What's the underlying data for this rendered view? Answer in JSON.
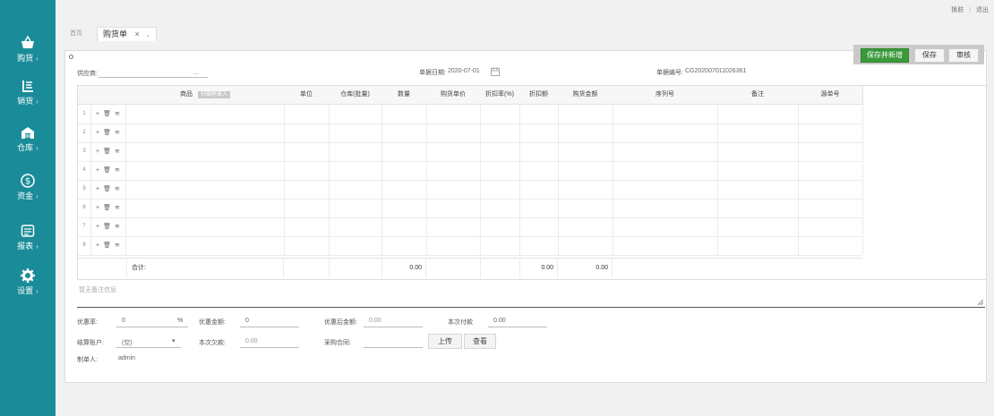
{
  "topbar": {
    "skin": "换肤",
    "separator": "|",
    "logout": "退出"
  },
  "sidebar": {
    "items": [
      {
        "label": "购货",
        "icon": "basket-icon"
      },
      {
        "label": "销货",
        "icon": "sales-icon"
      },
      {
        "label": "仓库",
        "icon": "warehouse-icon"
      },
      {
        "label": "资金",
        "icon": "dollar-icon"
      },
      {
        "label": "报表",
        "icon": "report-icon"
      },
      {
        "label": "设置",
        "icon": "gear-icon"
      }
    ],
    "arrow": "›"
  },
  "tabs": {
    "home": "首页",
    "active": "购货单",
    "close": "×",
    "more": "⌄"
  },
  "actions": {
    "save_new": "保存并新增",
    "save": "保存",
    "audit": "审核"
  },
  "header": {
    "supplier_label": "供应商:",
    "supplier_more": "...",
    "date_label": "单据日期:",
    "date_value": "2020-07-01",
    "number_label": "单据编号:",
    "number_value": "CG202007011026361"
  },
  "grid": {
    "columns": {
      "product": "商品",
      "scan": "扫描枪录入",
      "unit": "单位",
      "warehouse": "仓库(批量)",
      "qty": "数量",
      "price": "购货单价",
      "discount_rate": "折扣率(%)",
      "discount_amount": "折扣额",
      "amount": "购货金额",
      "serial": "序列号",
      "note": "备注",
      "source_no": "源单号"
    },
    "rows": [
      "1",
      "2",
      "3",
      "4",
      "5",
      "6",
      "7",
      "8"
    ],
    "row_ops": {
      "add": "+",
      "delete": "🗑",
      "batch": "≋"
    },
    "totals": {
      "label": "合计:",
      "qty": "0.00",
      "discount_amount": "0.00",
      "amount": "0.00"
    }
  },
  "remarks_placeholder": "暂无备注信息",
  "footer": {
    "discount_rate_label": "优惠率:",
    "discount_rate_value": "0",
    "percent": "%",
    "discount_amount_label": "优惠金额:",
    "discount_amount_value": "0",
    "after_discount_label": "优惠后金额:",
    "after_discount_value": "0.00",
    "payment_label": "本次付款",
    "payment_value": "0.00",
    "account_label": "结算账户:",
    "account_value": "(空)",
    "debt_label": "本次欠款:",
    "debt_value": "0.00",
    "contract_label": "采购合同:",
    "upload": "上传",
    "view": "查看",
    "maker_label": "制单人:",
    "maker_value": "admin"
  },
  "colors": {
    "sidebar": "#1a8c99",
    "save_new": "#3a9a3a"
  }
}
